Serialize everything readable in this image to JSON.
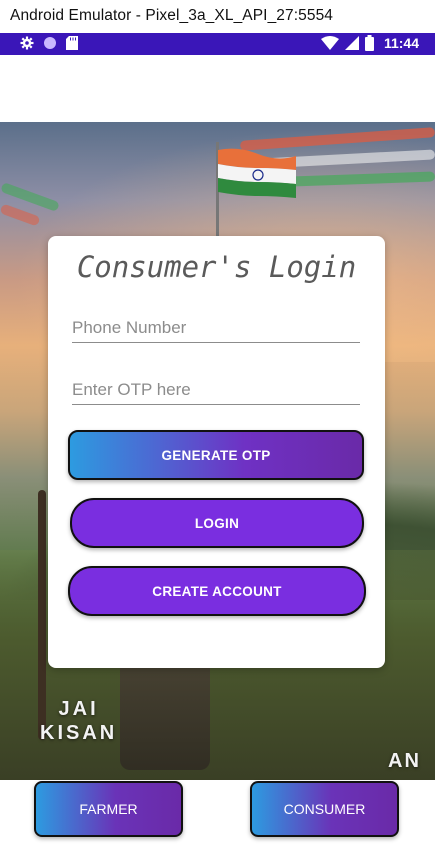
{
  "window": {
    "title": "Android Emulator - Pixel_3a_XL_API_27:5554"
  },
  "status_bar": {
    "time": "11:44",
    "left_icons": [
      "gear-icon",
      "circle-icon",
      "sd-card-icon"
    ],
    "right_icons": [
      "wifi-icon",
      "signal-icon",
      "battery-icon"
    ],
    "color": "#3a16b8"
  },
  "background": {
    "caption_line1": "JAI",
    "caption_line2": "KISAN",
    "caption_right": "AN"
  },
  "login_card": {
    "title": "Consumer's Login",
    "phone": {
      "placeholder": "Phone Number",
      "value": ""
    },
    "otp": {
      "placeholder": "Enter OTP here",
      "value": ""
    },
    "generate_label": "GENERATE OTP",
    "login_label": "LOGIN",
    "create_label": "CREATE ACCOUNT"
  },
  "bottom_nav": {
    "farmer_label": "FARMER",
    "consumer_label": "CONSUMER"
  },
  "colors": {
    "accent": "#7a2ee0",
    "gradient_start": "#2d9be0",
    "gradient_end": "#6a2aa8"
  }
}
